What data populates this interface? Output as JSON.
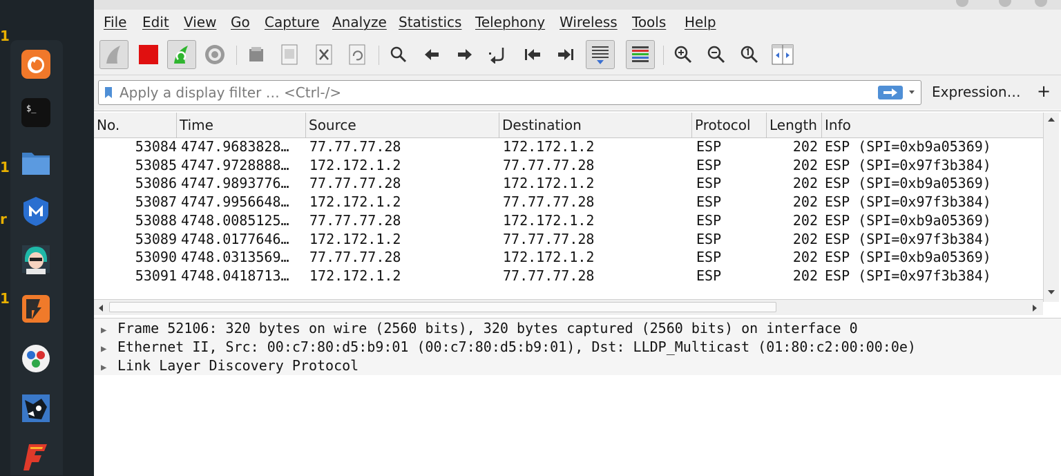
{
  "desktop": {
    "workspace_numbers": [
      "1",
      "1",
      "r",
      "1"
    ]
  },
  "dock": {
    "items": [
      {
        "name": "firefox-icon"
      },
      {
        "name": "terminal-icon",
        "label": "$_"
      },
      {
        "name": "files-icon"
      },
      {
        "name": "metasploit-icon"
      },
      {
        "name": "anime-avatar-icon"
      },
      {
        "name": "burpsuite-icon"
      },
      {
        "name": "maltego-icon"
      },
      {
        "name": "beef-icon"
      },
      {
        "name": "faraday-icon"
      }
    ]
  },
  "menubar": {
    "items": [
      "File",
      "Edit",
      "View",
      "Go",
      "Capture",
      "Analyze",
      "Statistics",
      "Telephony",
      "Wireless",
      "Tools",
      "Help"
    ]
  },
  "filter": {
    "placeholder": "Apply a display filter … <Ctrl-/>",
    "value": "",
    "expression_label": "Expression…",
    "plus_label": "+"
  },
  "packet_list": {
    "columns": [
      "No.",
      "Time",
      "Source",
      "Destination",
      "Protocol",
      "Length",
      "Info"
    ],
    "rows": [
      {
        "no": "53084",
        "time": "4747.9683828…",
        "source": "77.77.77.28",
        "destination": "172.172.1.2",
        "protocol": "ESP",
        "length": "202",
        "info": "ESP (SPI=0xb9a05369)"
      },
      {
        "no": "53085",
        "time": "4747.9728888…",
        "source": "172.172.1.2",
        "destination": "77.77.77.28",
        "protocol": "ESP",
        "length": "202",
        "info": "ESP (SPI=0x97f3b384)"
      },
      {
        "no": "53086",
        "time": "4747.9893776…",
        "source": "77.77.77.28",
        "destination": "172.172.1.2",
        "protocol": "ESP",
        "length": "202",
        "info": "ESP (SPI=0xb9a05369)"
      },
      {
        "no": "53087",
        "time": "4747.9956648…",
        "source": "172.172.1.2",
        "destination": "77.77.77.28",
        "protocol": "ESP",
        "length": "202",
        "info": "ESP (SPI=0x97f3b384)"
      },
      {
        "no": "53088",
        "time": "4748.0085125…",
        "source": "77.77.77.28",
        "destination": "172.172.1.2",
        "protocol": "ESP",
        "length": "202",
        "info": "ESP (SPI=0xb9a05369)"
      },
      {
        "no": "53089",
        "time": "4748.0177646…",
        "source": "172.172.1.2",
        "destination": "77.77.77.28",
        "protocol": "ESP",
        "length": "202",
        "info": "ESP (SPI=0x97f3b384)"
      },
      {
        "no": "53090",
        "time": "4748.0313569…",
        "source": "77.77.77.28",
        "destination": "172.172.1.2",
        "protocol": "ESP",
        "length": "202",
        "info": "ESP (SPI=0xb9a05369)"
      },
      {
        "no": "53091",
        "time": "4748.0418713…",
        "source": "172.172.1.2",
        "destination": "77.77.77.28",
        "protocol": "ESP",
        "length": "202",
        "info": "ESP (SPI=0x97f3b384)"
      }
    ]
  },
  "details": {
    "rows": [
      "Frame 52106: 320 bytes on wire (2560 bits), 320 bytes captured (2560 bits) on interface 0",
      "Ethernet II, Src: 00:c7:80:d5:b9:01 (00:c7:80:d5:b9:01), Dst: LLDP_Multicast (01:80:c2:00:00:0e)",
      "Link Layer Discovery Protocol"
    ]
  },
  "colors": {
    "accent_blue": "#4f8fd6",
    "capture_red": "#e01010",
    "shark_green": "#2fb52f",
    "desktop_number": "#e8b000"
  }
}
